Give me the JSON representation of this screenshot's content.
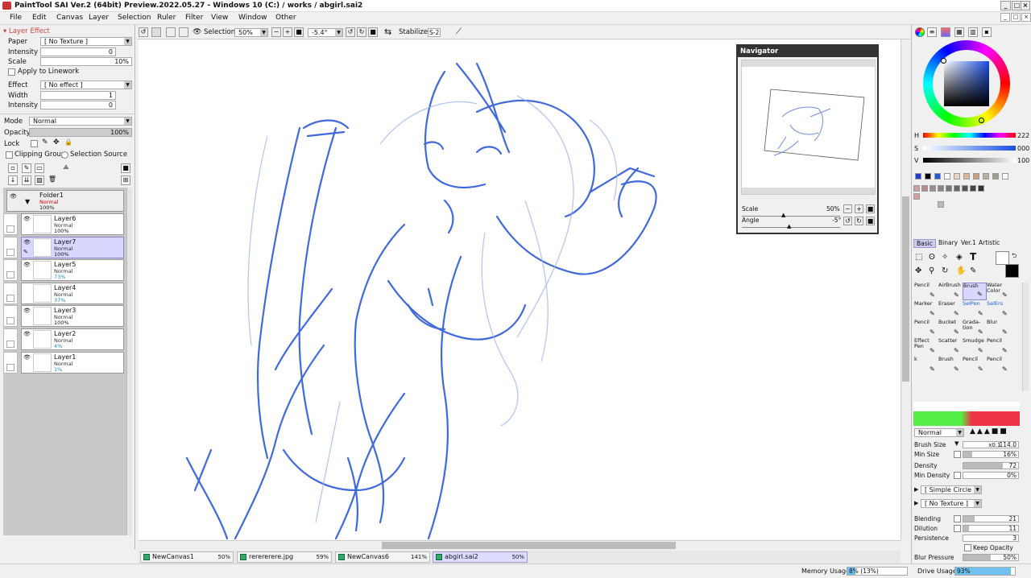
{
  "window": {
    "title": "PaintTool SAI Ver.2 (64bit) Preview.2022.05.27 - Windows 10 (C:) / works / abgirl.sai2"
  },
  "menu": [
    "File",
    "Edit",
    "Canvas",
    "Layer",
    "Selection",
    "Ruler",
    "Filter",
    "View",
    "Window",
    "Other"
  ],
  "layer_effect": {
    "header": "Layer Effect",
    "paper_label": "Paper",
    "paper_value": "[ No Texture ]",
    "intensity_label": "Intensity",
    "intensity_value": "0",
    "scale_label": "Scale",
    "scale_value": "10%",
    "apply_linework": "Apply to Linework",
    "effect_label": "Effect",
    "effect_value": "[ No effect ]",
    "width_label": "Width",
    "width_value": "1",
    "intensity2_label": "Intensity",
    "intensity2_value": "0"
  },
  "layer_props": {
    "mode_label": "Mode",
    "mode_value": "Normal",
    "opacity_label": "Opacity",
    "opacity_value": "100%",
    "lock_label": "Lock",
    "clipping_group": "Clipping Group",
    "selection_source": "Selection Source"
  },
  "folder": {
    "name": "Folder1",
    "mode": "Normal",
    "opacity": "100%"
  },
  "layers": [
    {
      "name": "Layer6",
      "mode": "Normal",
      "opacity": "100%"
    },
    {
      "name": "Layer7",
      "mode": "Normal",
      "opacity": "100%"
    },
    {
      "name": "Layer5",
      "mode": "Normal",
      "opacity": "73%"
    },
    {
      "name": "Layer4",
      "mode": "Normal",
      "opacity": "37%"
    },
    {
      "name": "Layer3",
      "mode": "Normal",
      "opacity": "100%"
    },
    {
      "name": "Layer2",
      "mode": "Normal",
      "opacity": "4%"
    },
    {
      "name": "Layer1",
      "mode": "Normal",
      "opacity": "1%"
    }
  ],
  "canvas_toolbar": {
    "selection_label": "Selection",
    "zoom_value": "50%",
    "angle_value": "-5.4°",
    "stabilizer_label": "Stabilizer",
    "stabilizer_value": "S-2"
  },
  "navigator": {
    "title": "Navigator",
    "scale_label": "Scale",
    "scale_value": "50%",
    "angle_label": "Angle",
    "angle_value": "-5°"
  },
  "doc_tabs": [
    {
      "name": "NewCanvas1",
      "zoom": "50%"
    },
    {
      "name": "rerererere.jpg",
      "zoom": "59%"
    },
    {
      "name": "NewCanvas6",
      "zoom": "141%"
    },
    {
      "name": "abgirl.sai2",
      "zoom": "50%"
    }
  ],
  "status": {
    "memory_label": "Memory Usage",
    "memory_value": "8% (13%)",
    "drive_label": "Drive Usage",
    "drive_value": "93%"
  },
  "color": {
    "h_label": "H",
    "h_value": "222",
    "s_label": "S",
    "s_value": "000",
    "v_label": "V",
    "v_value": "100",
    "current_color": "#2a56d6"
  },
  "tool_tabs": [
    "Basic",
    "Binary",
    "Ver.1",
    "Artistic"
  ],
  "tools": [
    {
      "label": "Pencil"
    },
    {
      "label": "AirBrush"
    },
    {
      "label": "Brush"
    },
    {
      "label": "Water Color"
    },
    {
      "label": "Marker"
    },
    {
      "label": "Eraser"
    },
    {
      "label": "SelPen"
    },
    {
      "label": "SelErs"
    },
    {
      "label": "Pencil"
    },
    {
      "label": "Bucket"
    },
    {
      "label": "Grada-tion"
    },
    {
      "label": "Blur"
    },
    {
      "label": "Effect Pen"
    },
    {
      "label": "Scatter"
    },
    {
      "label": "Smudge"
    },
    {
      "label": "Pencil"
    },
    {
      "label": "k"
    },
    {
      "label": "Brush"
    },
    {
      "label": "Pencil"
    },
    {
      "label": "Pencil"
    }
  ],
  "brush": {
    "mode_value": "Normal",
    "size_label": "Brush Size",
    "size_mult": "x0.1",
    "size_value": "114.0",
    "min_size_label": "Min Size",
    "min_size_value": "16%",
    "density_label": "Density",
    "density_value": "72",
    "min_density_label": "Min Density",
    "min_density_value": "0%",
    "shape_value": "[ Simple Circle ]",
    "texture_value": "[ No Texture ]",
    "blending_label": "Blending",
    "blending_value": "21",
    "dilution_label": "Dilution",
    "dilution_value": "11",
    "persistence_label": "Persistence",
    "persistence_value": "3",
    "keep_opacity": "Keep Opacity",
    "blur_pressure_label": "Blur Pressure",
    "blur_pressure_value": "50%"
  }
}
